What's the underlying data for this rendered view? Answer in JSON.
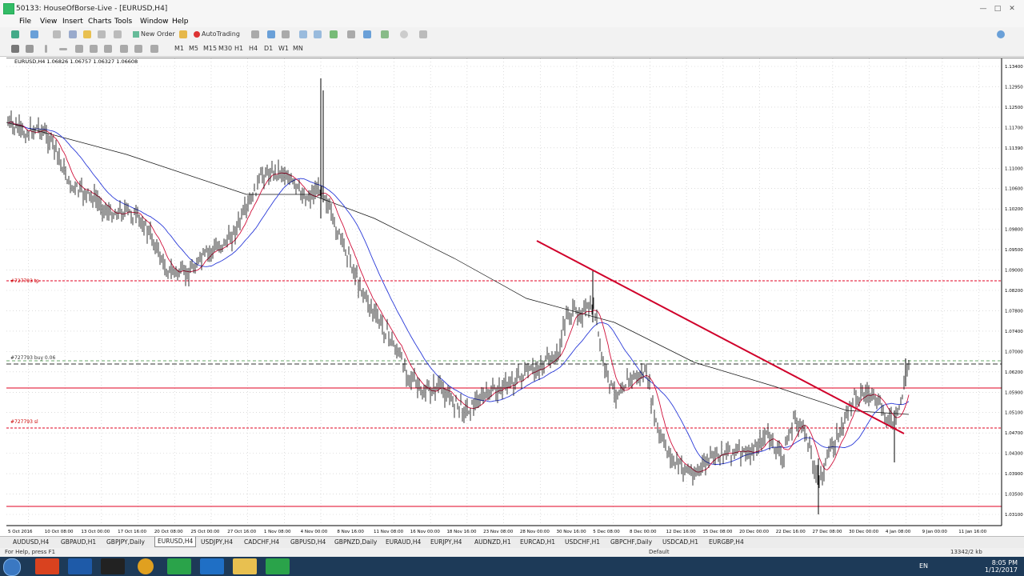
{
  "window": {
    "title": "50133: HouseOfBorse-Live - [EURUSD,H4]"
  },
  "menu": [
    "File",
    "View",
    "Insert",
    "Charts",
    "Tools",
    "Window",
    "Help"
  ],
  "toolbar": {
    "new_order": "New Order",
    "autotrading": "AutoTrading"
  },
  "timeframes": [
    "M1",
    "M5",
    "M15",
    "M30",
    "H1",
    "H4",
    "D1",
    "W1",
    "MN"
  ],
  "chart": {
    "header": "EURUSD,H4  1.06826 1.06757 1.06327 1.06608",
    "order_labels": [
      "#727793 tp",
      "#727793 buy 0.06",
      "#727793 sl"
    ],
    "price_axis": [
      "1.13400",
      "1.12950",
      "1.12500",
      "1.11700",
      "1.11390",
      "1.11000",
      "1.10600",
      "1.10200",
      "1.09800",
      "1.09500",
      "1.09000",
      "1.08200",
      "1.07800",
      "1.07400",
      "1.07000",
      "1.06200",
      "1.05900",
      "1.05100",
      "1.04700",
      "1.04300",
      "1.03900",
      "1.03500",
      "1.03100"
    ],
    "marked_prices": [
      {
        "label": "1.08568",
        "color": "#e00020"
      },
      {
        "label": "1.06608",
        "color": "#333333"
      },
      {
        "label": "1.06184",
        "color": "#e00020"
      },
      {
        "label": "1.05288",
        "color": "#e00020"
      },
      {
        "label": "1.03515",
        "color": "#e00020"
      }
    ],
    "time_axis": [
      "5 Oct 2016",
      "10 Oct 08:00",
      "13 Oct 00:00",
      "17 Oct 16:00",
      "20 Oct 08:00",
      "25 Oct 00:00",
      "27 Oct 16:00",
      "1 Nov 08:00",
      "4 Nov 00:00",
      "8 Nov 16:00",
      "11 Nov 08:00",
      "16 Nov 00:00",
      "18 Nov 16:00",
      "23 Nov 08:00",
      "28 Nov 00:00",
      "30 Nov 16:00",
      "5 Dec 08:00",
      "8 Dec 00:00",
      "12 Dec 16:00",
      "15 Dec 08:00",
      "20 Dec 00:00",
      "22 Dec 16:00",
      "27 Dec 08:00",
      "30 Dec 00:00",
      "4 Jan 08:00",
      "9 Jan 00:00",
      "11 Jan 16:00"
    ]
  },
  "tabs": [
    "AUDUSD,H4",
    "GBPAUD,H1",
    "GBPJPY,Daily",
    "EURUSD,H4",
    "USDJPY,H4",
    "CADCHF,H4",
    "GBPUSD,H4",
    "GBPNZD,Daily",
    "EURAUD,H4",
    "EURJPY,H4",
    "AUDNZD,H1",
    "EURCAD,H1",
    "USDCHF,H1",
    "GBPCHF,Daily",
    "USDCAD,H1",
    "EURGBP,H4"
  ],
  "active_tab": "EURUSD,H4",
  "status": {
    "help": "For Help, press F1",
    "profile": "Default",
    "traffic": "13342/2 kb"
  },
  "taskbar": {
    "lang": "EN",
    "time": "8:05 PM",
    "date": "1/12/2017"
  }
}
